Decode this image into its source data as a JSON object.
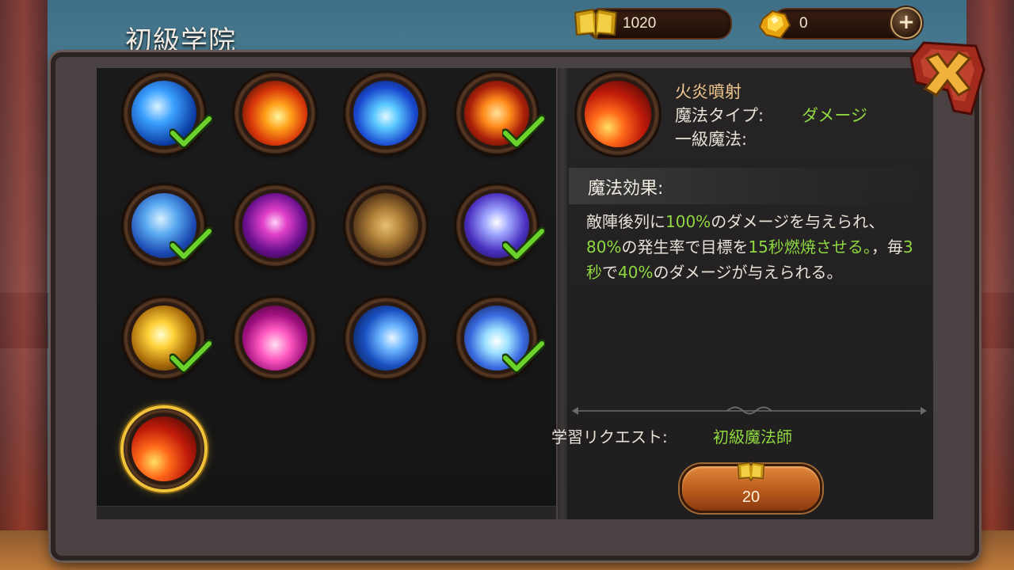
{
  "header": {
    "title": "初級学院",
    "book_currency": "1020",
    "gem_currency": "0",
    "add_button_label": "+"
  },
  "skills": [
    {
      "id": "water-vortex",
      "learned": true,
      "selected": false
    },
    {
      "id": "fireball",
      "learned": false,
      "selected": false
    },
    {
      "id": "ice-orb",
      "learned": false,
      "selected": false
    },
    {
      "id": "flame-burst",
      "learned": true,
      "selected": false
    },
    {
      "id": "whirlwind",
      "learned": true,
      "selected": false
    },
    {
      "id": "dark-skull",
      "learned": false,
      "selected": false
    },
    {
      "id": "stone-golem",
      "learned": false,
      "selected": false
    },
    {
      "id": "lightning",
      "learned": true,
      "selected": false
    },
    {
      "id": "holy-light",
      "learned": true,
      "selected": false
    },
    {
      "id": "pink-flame",
      "learned": false,
      "selected": false
    },
    {
      "id": "blue-crescent",
      "learned": false,
      "selected": false
    },
    {
      "id": "ice-lotus",
      "learned": true,
      "selected": false
    },
    {
      "id": "fire-meteor",
      "learned": false,
      "selected": true
    }
  ],
  "detail": {
    "name": "火炎噴射",
    "type_label": "魔法タイプ:",
    "type_value": "ダメージ",
    "level_label": "一級魔法:",
    "effect_title": "魔法効果:",
    "desc_1": "敵陣後列に",
    "desc_2": "100%",
    "desc_3": "のダメージを与えられ、",
    "desc_4": "80%",
    "desc_5": "の発生率で目標を",
    "desc_6": "15秒燃焼させる。",
    "desc_7": "，毎",
    "desc_8": "3秒",
    "desc_9": "で",
    "desc_10": "40%",
    "desc_11": "のダメージが与えられる。",
    "request_label": "学習リクエスト:",
    "request_value": "初級魔法師",
    "cost": "20"
  },
  "colors": {
    "highlight_green": "#8fd840",
    "name_orange": "#f0c890",
    "selection_gold": "#f1c33a"
  }
}
